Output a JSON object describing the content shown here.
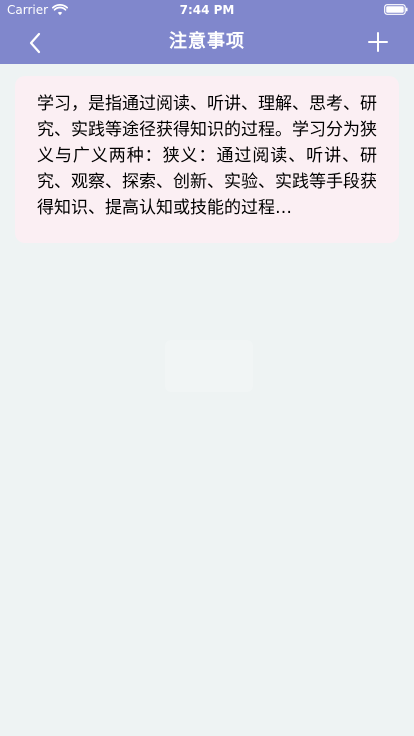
{
  "status_bar": {
    "carrier": "Carrier",
    "time": "7:44 PM",
    "wifi_icon": "wifi-icon",
    "battery_icon": "battery-icon"
  },
  "nav": {
    "title": "注意事项",
    "back_icon": "chevron-left-icon",
    "add_icon": "plus-icon"
  },
  "note": {
    "text": "学习，是指通过阅读、听讲、理解、思考、研究、实践等途径获得知识的过程。学习分为狭义与广义两种：狭义：通过阅读、听讲、研究、观察、探索、创新、实验、实践等手段获得知识、提高认知或技能的过程…"
  },
  "colors": {
    "nav_background": "#8087cc",
    "page_background": "#eef3f3",
    "card_background": "#fbeff3",
    "text": "#000000"
  }
}
